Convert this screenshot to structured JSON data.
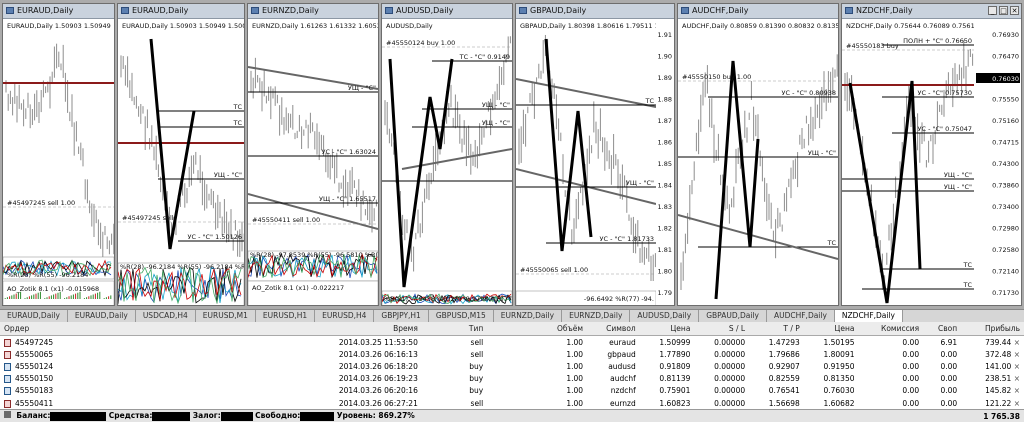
{
  "windows": [
    {
      "title": "EURAUD,Daily",
      "info": "EURAUD,Daily  1.50903 1.50949",
      "labels": [
        "#45497245 sell 1.00",
        "AO_Zotik 8.1 (x1) -0.015968"
      ],
      "ind": "%R(55) -96.2184"
    },
    {
      "title": "EURAUD,Daily",
      "info": "EURAUD,Daily  1.50903 1.50949 1.5004",
      "labels": [
        "ТС",
        "ТС",
        "УЩ - \"С\"",
        "#45497245 sell",
        "УС - \"С\" 1.50126"
      ],
      "ind": "%R(28) -96.2184 %R(55) -96.2184 %R(77"
    },
    {
      "title": "EURNZD,Daily",
      "info": "EURNZD,Daily  1.61263 1.61332 1.60537",
      "labels": [
        "УЩ - \"С\"",
        "УС - \"С\" 1.63024",
        "УЩ - \"С\" 1.65517",
        "#45550411 sell 1.00",
        "AO_Zotik 8.1 (x1) -0.022217"
      ],
      "ind": "%R(28) -97.8539 %R(55) -96.5810 %R(77"
    },
    {
      "title": "AUDUSD,Daily",
      "info": "AUDUSD,Daily",
      "labels": [
        "#45550124 buy 1.00",
        "ТС - \"С\" 0.9149",
        "УЩ - \"С\"",
        "УЩ - \"С\""
      ],
      "ind": "%R(21) -7.9458 %R(28) -9.9798 %R(77) -4"
    },
    {
      "title": "GBPAUD,Daily",
      "info": "GBPAUD,Daily  1.80398 1.80616 1.79511 1.79",
      "labels": [
        "ТС",
        "УЩ - \"С\"",
        "УС - \"С\" 1.81733",
        "#45550065 sell 1.00"
      ],
      "ind": "-96.6492 %R(77) -94.",
      "axis": [
        "1.91",
        "1.90",
        "1.89",
        "1.88",
        "1.87",
        "1.86",
        "1.85",
        "1.84",
        "1.83",
        "1.82",
        "1.81",
        "1.80",
        "1.79"
      ]
    },
    {
      "title": "AUDCHF,Daily",
      "info": "AUDCHF,Daily  0.80859 0.81390 0.80832 0.81350",
      "labels": [
        "#45550150 buy 1.00",
        "УС - \"С\" 0.80938",
        "УЩ - \"С\"",
        "ТС"
      ]
    },
    {
      "title": "NZDCHF,Daily",
      "info": "NZDCHF,Daily  0.75644 0.76089 0.75612 0.76",
      "labels": [
        "#45550183 buy",
        "ПОЛН + \"С\" 0.76650",
        "УС - \"С\" 0.75730",
        "УС - \"С\" 0.75047",
        "УЩ - \"С\"",
        "УЩ - \"С\"",
        "ТС",
        "ТС"
      ],
      "price_tag": "0.76030",
      "axis": [
        "0.76930",
        "0.76470",
        "0.76040",
        "0.75550",
        "0.75160",
        "0.74715",
        "0.74300",
        "0.73860",
        "0.73400",
        "0.72980",
        "0.72580",
        "0.72140",
        "0.71730"
      ]
    }
  ],
  "tabs": [
    "EURAUD,Daily",
    "EURAUD,Daily",
    "USDCAD,H4",
    "EURUSD,M1",
    "EURUSD,H1",
    "EURUSD,H4",
    "GBPJPY,H1",
    "GBPUSD,M15",
    "EURNZD,Daily",
    "EURNZD,Daily",
    "AUDUSD,Daily",
    "GBPAUD,Daily",
    "AUDCHF,Daily",
    "NZDCHF,Daily"
  ],
  "terminal": {
    "columns": [
      "Ордер",
      "Время",
      "Тип",
      "Объём",
      "Символ",
      "Цена",
      "S / L",
      "T / P",
      "Цена",
      "Комиссия",
      "Своп",
      "Прибыль"
    ],
    "rows": [
      [
        "45497245",
        "2014.03.25 11:53:50",
        "sell",
        "1.00",
        "euraud",
        "1.50999",
        "0.00000",
        "1.47293",
        "1.50195",
        "0.00",
        "6.91",
        "739.44"
      ],
      [
        "45550065",
        "2014.03.26 06:16:13",
        "sell",
        "1.00",
        "gbpaud",
        "1.77890",
        "0.00000",
        "1.79686",
        "1.80091",
        "0.00",
        "0.00",
        "372.48"
      ],
      [
        "45550124",
        "2014.03.26 06:18:20",
        "buy",
        "1.00",
        "audusd",
        "0.91809",
        "0.00000",
        "0.92907",
        "0.91950",
        "0.00",
        "0.00",
        "141.00"
      ],
      [
        "45550150",
        "2014.03.26 06:19:23",
        "buy",
        "1.00",
        "audchf",
        "0.81139",
        "0.00000",
        "0.82559",
        "0.81350",
        "0.00",
        "0.00",
        "238.51"
      ],
      [
        "45550183",
        "2014.03.26 06:20:16",
        "buy",
        "1.00",
        "nzdchf",
        "0.75901",
        "0.00000",
        "0.76541",
        "0.76030",
        "0.00",
        "0.00",
        "145.82"
      ],
      [
        "45550411",
        "2014.03.26 06:27:21",
        "sell",
        "1.00",
        "eurnzd",
        "1.60823",
        "0.00000",
        "1.56698",
        "1.60682",
        "0.00",
        "0.00",
        "121.22"
      ]
    ],
    "balance": {
      "b": "Баланс:",
      "eq": "Средства:",
      "mg": "Залог:",
      "fr": "Свободно:",
      "lvl": "Уровень: 869.27%",
      "total": "1 765.38"
    }
  }
}
